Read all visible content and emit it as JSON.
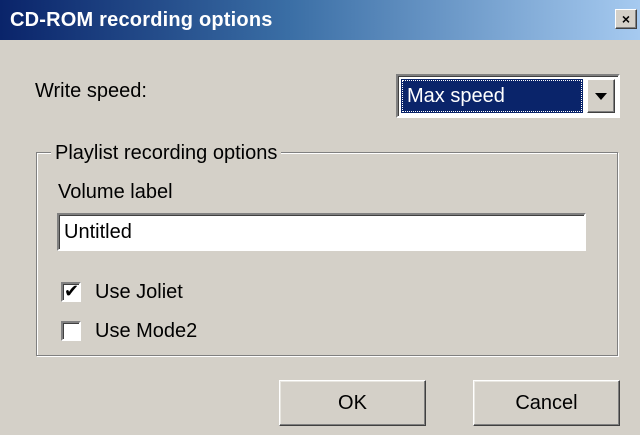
{
  "window": {
    "title": "CD-ROM recording options",
    "close_glyph": "×"
  },
  "write_speed": {
    "label": "Write speed:",
    "selected": "Max speed"
  },
  "playlist_group": {
    "legend": "Playlist recording options",
    "volume_label": "Volume label",
    "volume_value": "Untitled",
    "use_joliet": {
      "label": "Use Joliet",
      "checked": true
    },
    "use_mode2": {
      "label": "Use Mode2",
      "checked": false
    }
  },
  "buttons": {
    "ok": "OK",
    "cancel": "Cancel"
  },
  "icons": {
    "close": "close-icon",
    "dropdown": "chevron-down-icon",
    "check": "checkmark-icon"
  },
  "colors": {
    "titlebar_start": "#0a246a",
    "titlebar_end": "#a6caf0",
    "dialog_bg": "#d4d0c8",
    "selection_bg": "#0a246a"
  }
}
